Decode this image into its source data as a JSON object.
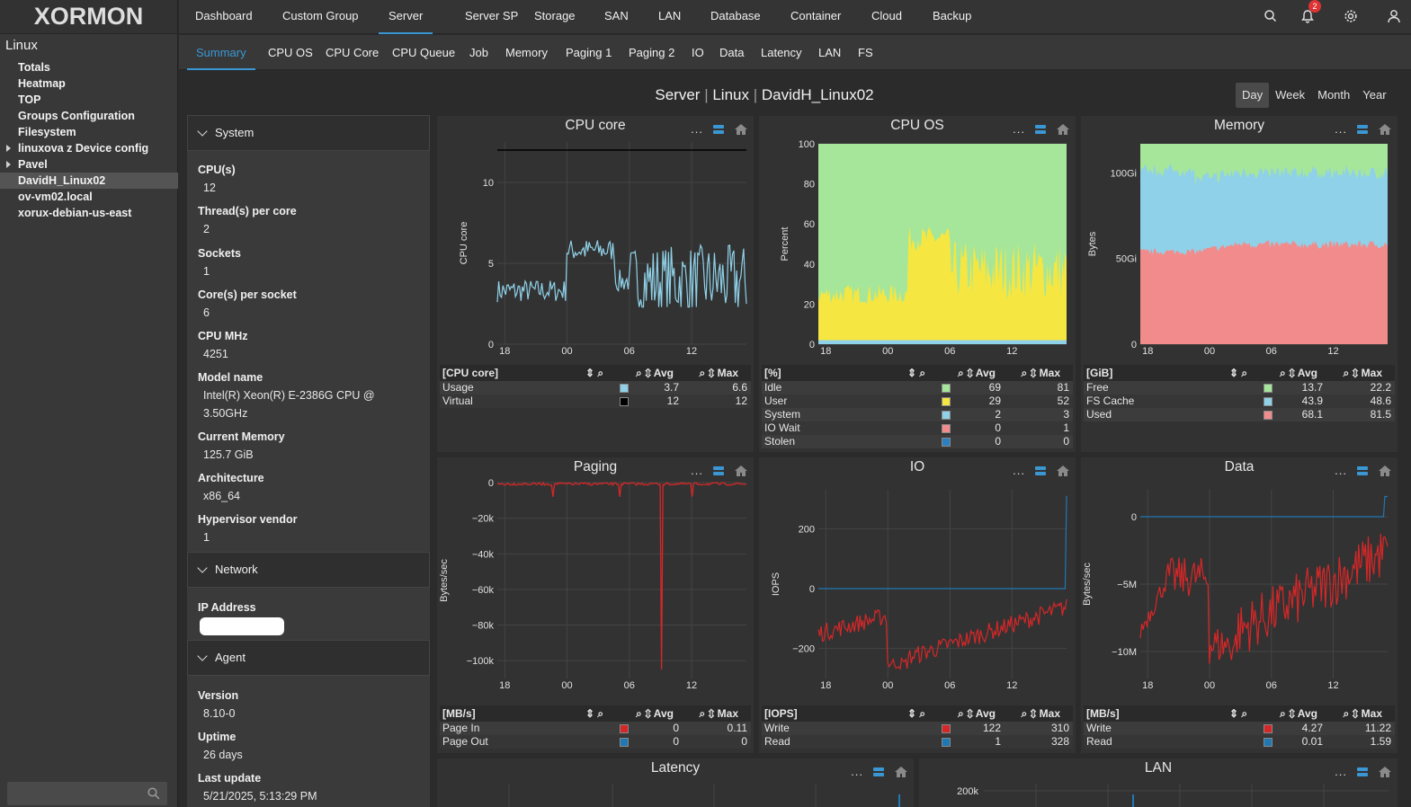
{
  "app": {
    "logo": "XORMON"
  },
  "tree": {
    "title": "Linux",
    "items": [
      {
        "label": "Totals",
        "plain": false,
        "caret": false,
        "sel": false
      },
      {
        "label": "Heatmap",
        "plain": false,
        "caret": false,
        "sel": false
      },
      {
        "label": "TOP",
        "plain": false,
        "caret": false,
        "sel": false
      },
      {
        "label": "Groups Configuration",
        "plain": false,
        "caret": false,
        "sel": false
      },
      {
        "label": "Filesystem",
        "plain": false,
        "caret": false,
        "sel": false
      },
      {
        "label": "linuxova z Device config",
        "plain": false,
        "caret": true,
        "sel": false
      },
      {
        "label": "Pavel",
        "plain": false,
        "caret": true,
        "sel": false
      },
      {
        "label": "DavidH_Linux02",
        "plain": false,
        "caret": false,
        "sel": true
      },
      {
        "label": "ov-vm02.local",
        "plain": false,
        "caret": false,
        "sel": false
      },
      {
        "label": "xorux-debian-us-east",
        "plain": false,
        "caret": false,
        "sel": false
      }
    ]
  },
  "nav": [
    "Dashboard",
    "Custom Group",
    "Server",
    "Server SP",
    "Storage",
    "SAN",
    "LAN",
    "Database",
    "Container",
    "Cloud",
    "Backup"
  ],
  "nav_active": "Server",
  "notifications": "2",
  "tabs": [
    "Summary",
    "CPU OS",
    "CPU Core",
    "CPU Queue",
    "Job",
    "Memory",
    "Paging 1",
    "Paging 2",
    "IO",
    "Data",
    "Latency",
    "LAN",
    "FS"
  ],
  "tab_active": "Summary",
  "title": {
    "p1": "Server",
    "p2": "Linux",
    "p3": "DavidH_Linux02",
    "sep": "|"
  },
  "periods": [
    "Day",
    "Week",
    "Month",
    "Year"
  ],
  "period_active": "Day",
  "info": {
    "system": "System",
    "network": "Network",
    "agent": "Agent",
    "fields": [
      {
        "label": "CPU(s)",
        "value": "12"
      },
      {
        "label": "Thread(s) per core",
        "value": "2"
      },
      {
        "label": "Sockets",
        "value": "1"
      },
      {
        "label": "Core(s) per socket",
        "value": "6"
      },
      {
        "label": "CPU MHz",
        "value": "4251"
      },
      {
        "label": "Model name",
        "value": "Intel(R) Xeon(R) E-2386G CPU @",
        "value2": "3.50GHz"
      },
      {
        "label": "Current Memory",
        "value": "125.7 GiB"
      },
      {
        "label": "Architecture",
        "value": "x86_64"
      },
      {
        "label": "Hypervisor vendor",
        "value": "1"
      }
    ],
    "ip_label": "IP Address",
    "agent_fields": [
      {
        "label": "Version",
        "value": "8.10-0"
      },
      {
        "label": "Uptime",
        "value": "26 days"
      },
      {
        "label": "Last update",
        "value": "5/21/2025, 5:13:29 PM"
      }
    ]
  },
  "chart_data": [
    {
      "id": "cpucore",
      "type": "line",
      "title": "CPU core",
      "ylabel": "CPU core",
      "ylim": [
        0,
        12.5
      ],
      "yticks": [
        "0",
        "5",
        "10"
      ],
      "xticks": [
        "18",
        "00",
        "06",
        "12"
      ],
      "unit": "[CPU core]",
      "rows": [
        {
          "name": "Usage",
          "color": "#8fd1e8",
          "avg": "3.7",
          "max": "6.6"
        },
        {
          "name": "Virtual",
          "color": "#000000",
          "avg": "12",
          "max": "12"
        }
      ]
    },
    {
      "id": "cpuos",
      "type": "area",
      "title": "CPU OS",
      "ylabel": "Percent",
      "ylim": [
        0,
        100
      ],
      "yticks": [
        "0",
        "20",
        "40",
        "60",
        "80",
        "100"
      ],
      "xticks": [
        "18",
        "00",
        "06",
        "12"
      ],
      "unit": "[%]",
      "rows": [
        {
          "name": "Idle",
          "color": "#a6e69a",
          "avg": "69",
          "max": "81"
        },
        {
          "name": "User",
          "color": "#f5e642",
          "avg": "29",
          "max": "52"
        },
        {
          "name": "System",
          "color": "#8fd1e8",
          "avg": "2",
          "max": "3"
        },
        {
          "name": "IO Wait",
          "color": "#f28c8c",
          "avg": "0",
          "max": "1"
        },
        {
          "name": "Stolen",
          "color": "#2a7fc1",
          "avg": "0",
          "max": "0"
        }
      ]
    },
    {
      "id": "memory",
      "type": "area",
      "title": "Memory",
      "ylabel": "Bytes",
      "ylim": [
        0,
        125.7
      ],
      "yticks": [
        "0",
        "50Gi",
        "100Gi"
      ],
      "xticks": [
        "18",
        "00",
        "06",
        "12"
      ],
      "unit": "[GiB]",
      "rows": [
        {
          "name": "Free",
          "color": "#a6e69a",
          "avg": "13.7",
          "max": "22.2"
        },
        {
          "name": "FS Cache",
          "color": "#8fd1e8",
          "avg": "43.9",
          "max": "48.6"
        },
        {
          "name": "Used",
          "color": "#f28c8c",
          "avg": "68.1",
          "max": "81.5"
        }
      ]
    },
    {
      "id": "paging",
      "type": "line",
      "title": "Paging",
      "ylabel": "Bytes/sec",
      "ylim": [
        -110000,
        0
      ],
      "yticks": [
        "0",
        "−20k",
        "−40k",
        "−60k",
        "−80k",
        "−100k"
      ],
      "xticks": [
        "18",
        "00",
        "06",
        "12"
      ],
      "unit": "[MB/s]",
      "rows": [
        {
          "name": "Page In",
          "color": "#d62728",
          "avg": "0",
          "max": "0.11"
        },
        {
          "name": "Page Out",
          "color": "#1f77b4",
          "avg": "0",
          "max": "0"
        }
      ]
    },
    {
      "id": "io",
      "type": "line",
      "title": "IO",
      "ylabel": "IOPS",
      "ylim": [
        -300,
        330
      ],
      "yticks": [
        "200",
        "0",
        "−200"
      ],
      "xticks": [
        "18",
        "00",
        "06",
        "12"
      ],
      "unit": "[IOPS]",
      "rows": [
        {
          "name": "Write",
          "color": "#d62728",
          "avg": "122",
          "max": "310"
        },
        {
          "name": "Read",
          "color": "#1f77b4",
          "avg": "1",
          "max": "328"
        }
      ]
    },
    {
      "id": "data",
      "type": "line",
      "title": "Data",
      "ylabel": "Bytes/sec",
      "ylim": [
        -12000000,
        2000000
      ],
      "yticks": [
        "0",
        "−5M",
        "−10M"
      ],
      "xticks": [
        "18",
        "00",
        "06",
        "12"
      ],
      "unit": "[MB/s]",
      "rows": [
        {
          "name": "Write",
          "color": "#d62728",
          "avg": "4.27",
          "max": "11.22"
        },
        {
          "name": "Read",
          "color": "#1f77b4",
          "avg": "0.01",
          "max": "1.59"
        }
      ]
    },
    {
      "id": "latency",
      "type": "line",
      "title": "Latency"
    },
    {
      "id": "lan",
      "type": "line",
      "title": "LAN",
      "yticks": [
        "200k"
      ]
    }
  ],
  "table_hdr": {
    "avg": "Avg",
    "max": "Max"
  },
  "colors": {
    "accent": "#3b97d3",
    "icon_blue": "#3b97d3"
  }
}
